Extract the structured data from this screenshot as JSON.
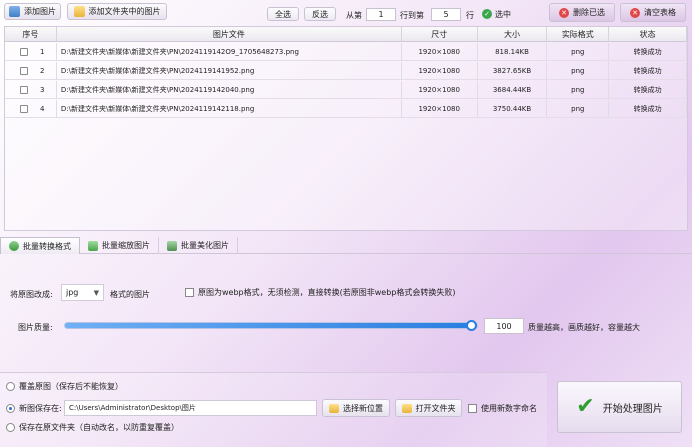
{
  "toolbar": {
    "add_image": "添加图片",
    "add_folder": "添加文件夹中的图片",
    "select_all": "全选",
    "invert": "反选",
    "from_label": "从第",
    "from_value": "1",
    "to_label": "行到第",
    "to_value": "5",
    "row_label": "行",
    "select_label": "选中",
    "delete_selected": "删除已选",
    "clear_table": "清空表格"
  },
  "table": {
    "headers": [
      "序号",
      "图片文件",
      "尺寸",
      "大小",
      "实际格式",
      "状态"
    ],
    "rows": [
      {
        "no": "1",
        "file": "D:\\新建文件夹\\新媒体\\新建文件夹\\PN\\2024119142O9_1705648273.png",
        "size": "1920×1080",
        "bytes": "818.14KB",
        "format": "png",
        "status": "转换成功"
      },
      {
        "no": "2",
        "file": "D:\\新建文件夹\\新媒体\\新建文件夹\\PN\\2024119141952.png",
        "size": "1920×1080",
        "bytes": "3827.65KB",
        "format": "png",
        "status": "转换成功"
      },
      {
        "no": "3",
        "file": "D:\\新建文件夹\\新媒体\\新建文件夹\\PN\\2024119142040.png",
        "size": "1920×1080",
        "bytes": "3684.44KB",
        "format": "png",
        "status": "转换成功"
      },
      {
        "no": "4",
        "file": "D:\\新建文件夹\\新媒体\\新建文件夹\\PN\\2024119142118.png",
        "size": "1920×1080",
        "bytes": "3750.44KB",
        "format": "png",
        "status": "转换成功"
      }
    ]
  },
  "tabs": [
    "批量转换格式",
    "批量缩放图片",
    "批量美化图片"
  ],
  "convert": {
    "convert_label": "将原图改成:",
    "format_value": "jpg",
    "format_suffix": "格式的图片",
    "webp_check": "原图为webp格式，无须检测，直接转换(若原图非webp格式会转换失败)",
    "quality_label": "图片质量:",
    "quality_value": "100",
    "quality_note": "质量越高，画质越好，容量越大",
    "quality_fraction": 1.0
  },
  "save": {
    "overwrite": "覆盖原图（保存后不能恢复）",
    "new_save": "新图保存在:",
    "path": "C:\\Users\\Administrator\\Desktop\\图片",
    "choose_location": "选择新位置",
    "open_folder": "打开文件夹",
    "new_name": "使用新数字命名",
    "save_original": "保存在原文件夹（自动改名，以防重复覆盖）",
    "start": "开始处理图片"
  }
}
